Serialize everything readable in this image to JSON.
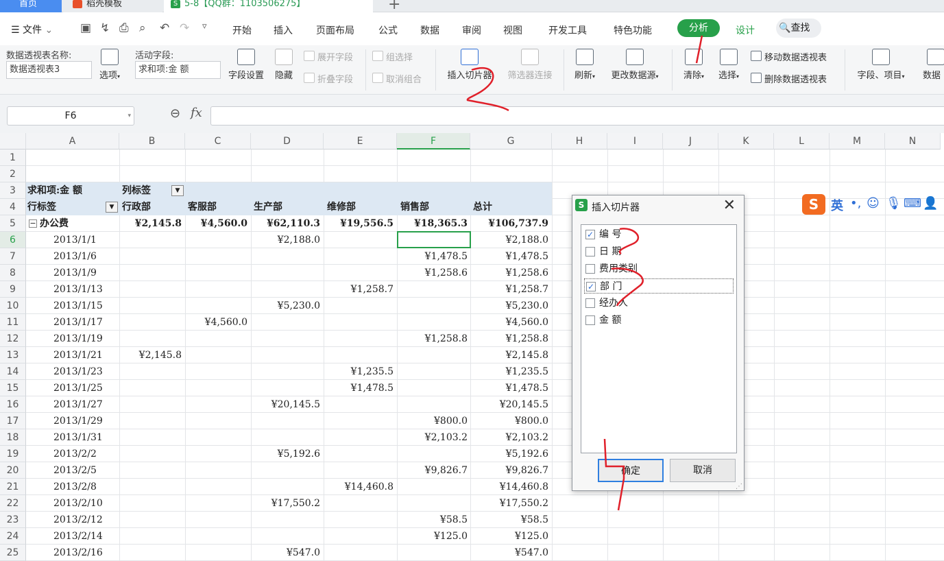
{
  "tabs": {
    "home": "首页",
    "template": "稻壳模板",
    "doc": "5-8【QQ群：1103506275】",
    "doc_icon": "S"
  },
  "menu": {
    "file": "文件",
    "items": [
      "开始",
      "插入",
      "页面布局",
      "公式",
      "数据",
      "审阅",
      "视图",
      "开发工具",
      "特色功能"
    ],
    "analyze": "分析",
    "design": "设计",
    "search": "查找"
  },
  "toolbar": {
    "pivot_name_label": "数据透视表名称:",
    "pivot_name_value": "数据透视表3",
    "options": "选项",
    "active_field_label": "活动字段:",
    "active_field_value": "求和项:金 额",
    "field_settings": "字段设置",
    "hide": "隐藏",
    "expand_field": "展开字段",
    "collapse_field": "折叠字段",
    "group_select": "组选择",
    "ungroup": "取消组合",
    "insert_slicer": "插入切片器",
    "filter_connections": "筛选器连接",
    "refresh": "刷新",
    "change_source": "更改数据源",
    "clear": "清除",
    "select": "选择",
    "move_pivot": "移动数据透视表",
    "delete_pivot": "删除数据透视表",
    "fields_items": "字段、项目",
    "data_cut": "数据"
  },
  "formula": {
    "name_box": "F6",
    "fx": "fx",
    "value": ""
  },
  "sheet": {
    "columns": [
      "A",
      "B",
      "C",
      "D",
      "E",
      "F",
      "G",
      "H",
      "I",
      "J",
      "K",
      "L",
      "M",
      "N"
    ],
    "rows": [
      "1",
      "2",
      "3",
      "4",
      "5",
      "6",
      "7",
      "8",
      "9",
      "10",
      "11",
      "12",
      "13",
      "14",
      "15",
      "16",
      "17",
      "18",
      "19",
      "20",
      "21",
      "22",
      "23",
      "24",
      "25"
    ],
    "pivot": {
      "sum_label": "求和项:金 额",
      "col_label": "列标签",
      "row_label": "行标签",
      "headers": [
        "行政部",
        "客服部",
        "生产部",
        "维修部",
        "销售部",
        "总计"
      ],
      "group": {
        "name": "办公费",
        "values": [
          "¥2,145.8",
          "¥4,560.0",
          "¥62,110.3",
          "¥19,556.5",
          "¥18,365.3",
          "¥106,737.9"
        ]
      },
      "rows": [
        {
          "date": "2013/1/1",
          "vals": [
            "",
            "",
            "¥2,188.0",
            "",
            "",
            "¥2,188.0"
          ]
        },
        {
          "date": "2013/1/6",
          "vals": [
            "",
            "",
            "",
            "",
            "¥1,478.5",
            "¥1,478.5"
          ]
        },
        {
          "date": "2013/1/9",
          "vals": [
            "",
            "",
            "",
            "",
            "¥1,258.6",
            "¥1,258.6"
          ]
        },
        {
          "date": "2013/1/13",
          "vals": [
            "",
            "",
            "",
            "¥1,258.7",
            "",
            "¥1,258.7"
          ]
        },
        {
          "date": "2013/1/15",
          "vals": [
            "",
            "",
            "¥5,230.0",
            "",
            "",
            "¥5,230.0"
          ]
        },
        {
          "date": "2013/1/17",
          "vals": [
            "",
            "¥4,560.0",
            "",
            "",
            "",
            "¥4,560.0"
          ]
        },
        {
          "date": "2013/1/19",
          "vals": [
            "",
            "",
            "",
            "",
            "¥1,258.8",
            "¥1,258.8"
          ]
        },
        {
          "date": "2013/1/21",
          "vals": [
            "¥2,145.8",
            "",
            "",
            "",
            "",
            "¥2,145.8"
          ]
        },
        {
          "date": "2013/1/23",
          "vals": [
            "",
            "",
            "",
            "¥1,235.5",
            "",
            "¥1,235.5"
          ]
        },
        {
          "date": "2013/1/25",
          "vals": [
            "",
            "",
            "",
            "¥1,478.5",
            "",
            "¥1,478.5"
          ]
        },
        {
          "date": "2013/1/27",
          "vals": [
            "",
            "",
            "¥20,145.5",
            "",
            "",
            "¥20,145.5"
          ]
        },
        {
          "date": "2013/1/29",
          "vals": [
            "",
            "",
            "",
            "",
            "¥800.0",
            "¥800.0"
          ]
        },
        {
          "date": "2013/1/31",
          "vals": [
            "",
            "",
            "",
            "",
            "¥2,103.2",
            "¥2,103.2"
          ]
        },
        {
          "date": "2013/2/2",
          "vals": [
            "",
            "",
            "¥5,192.6",
            "",
            "",
            "¥5,192.6"
          ]
        },
        {
          "date": "2013/2/5",
          "vals": [
            "",
            "",
            "",
            "",
            "¥9,826.7",
            "¥9,826.7"
          ]
        },
        {
          "date": "2013/2/8",
          "vals": [
            "",
            "",
            "",
            "¥14,460.8",
            "",
            "¥14,460.8"
          ]
        },
        {
          "date": "2013/2/10",
          "vals": [
            "",
            "",
            "¥17,550.2",
            "",
            "",
            "¥17,550.2"
          ]
        },
        {
          "date": "2013/2/12",
          "vals": [
            "",
            "",
            "",
            "",
            "¥58.5",
            "¥58.5"
          ]
        },
        {
          "date": "2013/2/14",
          "vals": [
            "",
            "",
            "",
            "",
            "¥125.0",
            "¥125.0"
          ]
        },
        {
          "date": "2013/2/16",
          "vals": [
            "",
            "",
            "¥547.0",
            "",
            "",
            "¥547.0"
          ]
        }
      ]
    }
  },
  "dialog": {
    "icon": "S",
    "title": "插入切片器",
    "close": "✕",
    "fields": [
      {
        "label": "编 号",
        "checked": true
      },
      {
        "label": "日 期",
        "checked": false
      },
      {
        "label": "费用类别",
        "checked": false
      },
      {
        "label": "部 门",
        "checked": true
      },
      {
        "label": "经办人",
        "checked": false
      },
      {
        "label": "金 额",
        "checked": false
      }
    ],
    "ok": "确定",
    "cancel": "取消"
  },
  "ime": {
    "logo": "S",
    "lang": "英"
  },
  "colors": {
    "accent": "#27a04a",
    "pivot_band": "#dde8f3",
    "annotation": "#e0202a"
  }
}
